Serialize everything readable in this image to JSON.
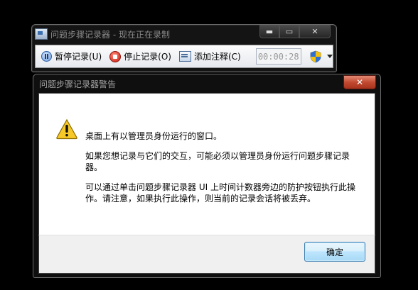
{
  "recorder": {
    "title": "问题步骤记录器 - 现在正在录制",
    "caption": {
      "minimize": "▬",
      "maximize": "▭",
      "close": "✕"
    },
    "toolbar": {
      "pause_label": "暂停记录(U)",
      "stop_label": "停止记录(O)",
      "comment_label": "添加注释(C)",
      "timer": "00:00:28"
    },
    "icons": [
      "pause-icon",
      "stop-icon",
      "comment-icon",
      "uac-shield-icon",
      "dropdown-arrow-icon"
    ]
  },
  "dialog": {
    "title": "问题步骤记录器警告",
    "close_glyph": "✕",
    "icon": "warning-icon",
    "messages": [
      "桌面上有以管理员身份运行的窗口。",
      "如果您想记录与它们的交互，可能必须以管理员身份运行问题步骤记录器。",
      "可以通过单击问题步骤记录器 UI 上时间计数器旁边的防护按钮执行此操作。请注意，如果执行此操作，则当前的记录会话将被丢弃。"
    ],
    "ok_label": "确定"
  },
  "colors": {
    "desktop": "#000000",
    "close_button": "#c24a31",
    "ok_border": "#3c7fb1",
    "timer_text": "#9a9a9a"
  }
}
